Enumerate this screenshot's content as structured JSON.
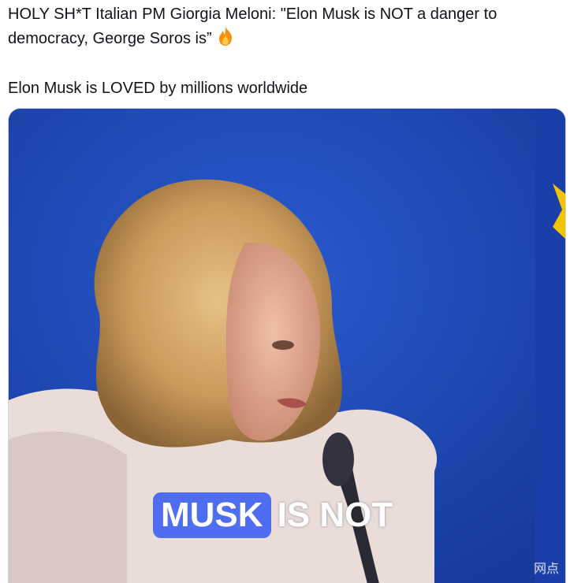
{
  "tweet": {
    "line1": "HOLY SH*T Italian PM Giorgia Meloni: \"Elon Musk is NOT a danger to",
    "line2": "democracy, George Soros is”",
    "line3": "Elon Musk is LOVED by millions worldwide",
    "emoji_icon": "fire-icon"
  },
  "media": {
    "caption_highlight": "MUSK",
    "caption_rest": "IS NOT",
    "watermark": "网点",
    "colors": {
      "background_blue": "#2048b8",
      "caption_highlight": "#4f6df0",
      "flag_star": "#f2c400"
    }
  }
}
